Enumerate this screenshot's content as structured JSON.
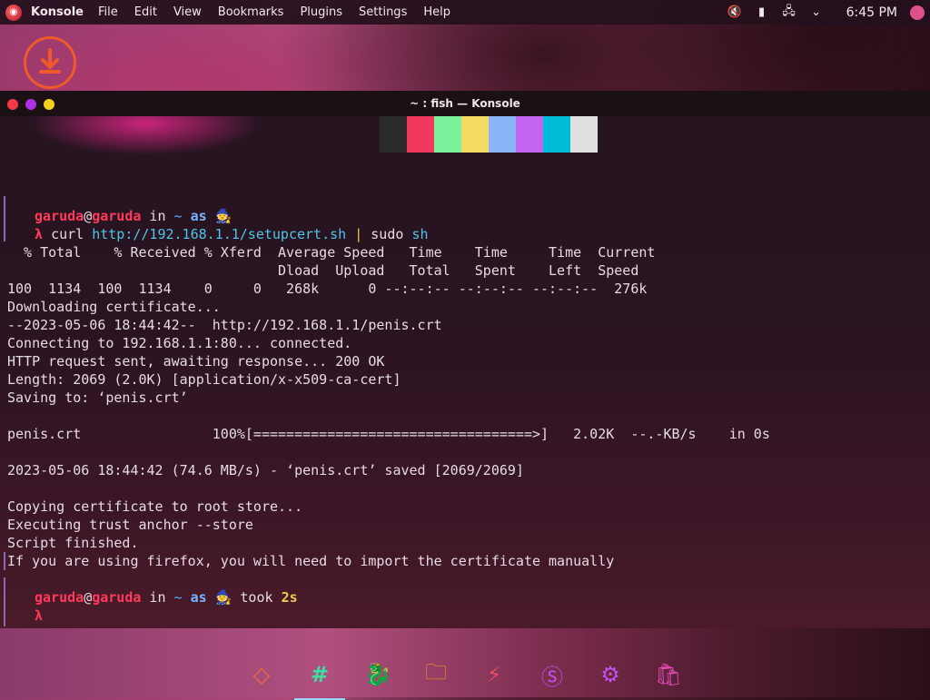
{
  "top_panel": {
    "app_name": "Konsole",
    "menus": [
      "File",
      "Edit",
      "View",
      "Bookmarks",
      "Plugins",
      "Settings",
      "Help"
    ],
    "clock": "6:45 PM"
  },
  "window": {
    "title": "~ : fish — Konsole"
  },
  "terminal": {
    "colors": [
      "#2a2a2a",
      "#f0385c",
      "#7cf09a",
      "#f4dc64",
      "#8ab4f8",
      "#c464f0",
      "#00bcd8",
      "#e0e0e0"
    ],
    "prompt1": {
      "user": "garuda",
      "at": "@",
      "host": "garuda",
      "in": " in ",
      "dir": "~",
      "as": "as",
      "wizard": "🧙"
    },
    "lambda": "λ",
    "command": {
      "curl": "curl",
      "url": "http://192.168.1.1/setupcert.sh",
      "pipe": "|",
      "sudo": "sudo",
      "sh": "sh"
    },
    "lines": [
      "  % Total    % Received % Xferd  Average Speed   Time    Time     Time  Current",
      "                                 Dload  Upload   Total   Spent    Left  Speed",
      "100  1134  100  1134    0     0   268k      0 --:--:-- --:--:-- --:--:--  276k",
      "Downloading certificate...",
      "--2023-05-06 18:44:42--  http://192.168.1.1/penis.crt",
      "Connecting to 192.168.1.1:80... connected.",
      "HTTP request sent, awaiting response... 200 OK",
      "Length: 2069 (2.0K) [application/x-x509-ca-cert]",
      "Saving to: ‘penis.crt’",
      "",
      "penis.crt                100%[==================================>]   2.02K  --.-KB/s    in 0s",
      "",
      "2023-05-06 18:44:42 (74.6 MB/s) - ‘penis.crt’ saved [2069/2069]",
      "",
      "Copying certificate to root store...",
      "Executing trust anchor --store",
      "Script finished.",
      "If you are using firefox, you will need to import the certificate manually"
    ],
    "prompt2": {
      "user": "garuda",
      "at": "@",
      "host": "garuda",
      "in": " in ",
      "dir": "~",
      "as": "as",
      "wizard": "🧙",
      "took": " took ",
      "duration": "2s"
    }
  },
  "dock": {
    "items": [
      "garuda-launcher",
      "konsole",
      "garuda-welcome",
      "files",
      "system-monitor",
      "octopi",
      "settings",
      "software-store"
    ],
    "glyphs": [
      "◇",
      "#",
      "🐉",
      "🗀",
      "⚡",
      "Ⓢ",
      "⚙",
      "🛍"
    ]
  }
}
